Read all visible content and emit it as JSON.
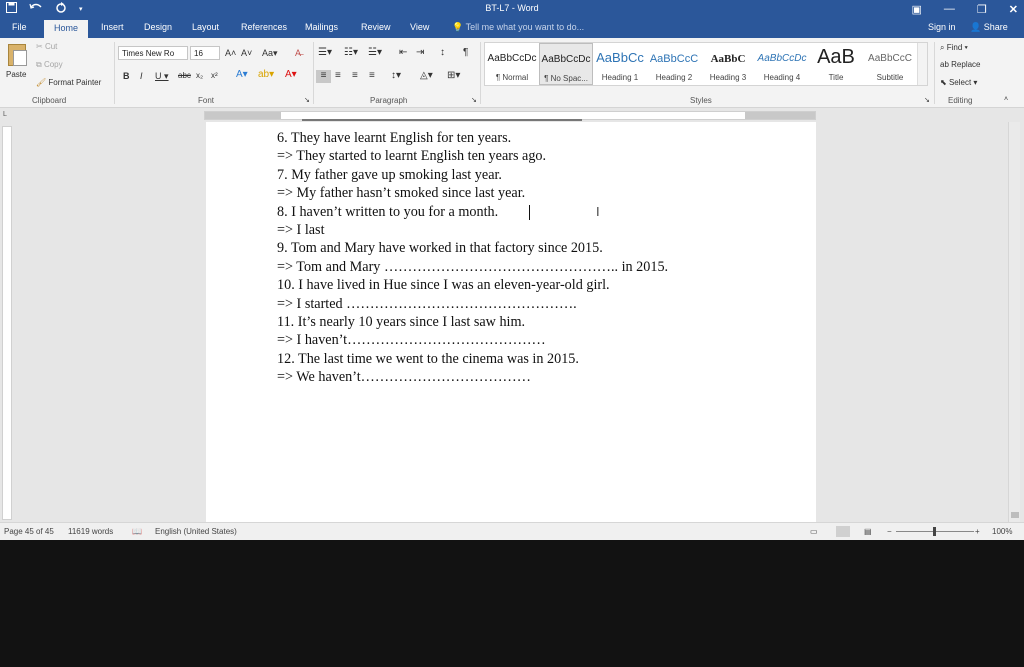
{
  "window": {
    "title": "BT-L7 - Word"
  },
  "quick_access": {
    "save_icon": "save-icon",
    "undo_icon": "undo-icon",
    "redo_icon": "redo-icon"
  },
  "tabs": {
    "file": "File",
    "home": "Home",
    "insert": "Insert",
    "design": "Design",
    "layout": "Layout",
    "references": "References",
    "mailings": "Mailings",
    "review": "Review",
    "view": "View",
    "tell_me": "Tell me what you want to do...",
    "sign_in": "Sign in",
    "share": "Share"
  },
  "clipboard": {
    "paste": "Paste",
    "cut": "Cut",
    "copy": "Copy",
    "format_painter": "Format Painter",
    "label": "Clipboard"
  },
  "font": {
    "name": "Times New Ro",
    "size": "16",
    "label": "Font"
  },
  "paragraph": {
    "label": "Paragraph"
  },
  "styles": {
    "label": "Styles",
    "items": [
      {
        "preview": "AaBbCcDc",
        "name": "¶ Normal"
      },
      {
        "preview": "AaBbCcDc",
        "name": "¶ No Spac..."
      },
      {
        "preview": "AaBbCc",
        "name": "Heading 1"
      },
      {
        "preview": "AaBbCcC",
        "name": "Heading 2"
      },
      {
        "preview": "AaBbC",
        "name": "Heading 3"
      },
      {
        "preview": "AaBbCcDc",
        "name": "Heading 4"
      },
      {
        "preview": "AaB",
        "name": "Title"
      },
      {
        "preview": "AaBbCcC",
        "name": "Subtitle"
      }
    ]
  },
  "editing": {
    "find": "Find",
    "replace": "Replace",
    "select": "Select",
    "label": "Editing"
  },
  "document": {
    "lines": [
      "6. They have learnt English for ten years.",
      "=> They started to learnt English  ten years ago.",
      "7. My father gave up smoking last year.",
      "=> My father hasn’t smoked since last year.",
      "8. I haven’t written to you for a month.",
      "=> I last",
      "9. Tom and Mary have worked in that factory since 2015.",
      "=> Tom and Mary ………………………………………….. in 2015.",
      "10. I have lived in Hue since I was an eleven-year-old girl.",
      "=> I started ………………………………………….",
      "11. It’s nearly 10 years since I last saw him.",
      "=>  I haven’t……………………………………",
      "12. The last time we went to the cinema was in 2015.",
      "=>  We haven’t………………………………"
    ]
  },
  "status": {
    "page": "Page 45 of 45",
    "words": "11619 words",
    "language": "English (United States)",
    "zoom": "100%"
  }
}
